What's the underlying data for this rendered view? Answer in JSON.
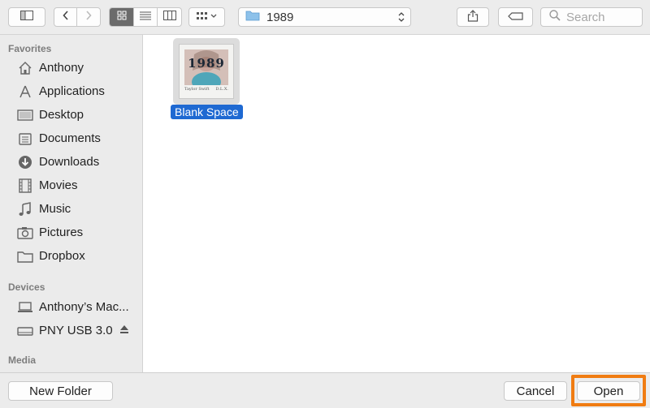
{
  "toolbar": {
    "sidebar_toggle_icon": "sidebar-icon",
    "back_icon": "chevron-left-icon",
    "forward_icon": "chevron-right-icon",
    "view_icons": [
      "icon-view-icon",
      "list-view-icon",
      "column-view-icon"
    ],
    "arrange_icon": "arrange-grid-icon",
    "path": {
      "folder_icon": "folder-icon",
      "label": "1989"
    },
    "share_icon": "share-icon",
    "tag_icon": "tag-icon",
    "search": {
      "icon": "search-icon",
      "placeholder": "Search"
    }
  },
  "sidebar": {
    "sections": [
      {
        "title": "Favorites",
        "items": [
          {
            "label": "Anthony",
            "icon": "home-icon"
          },
          {
            "label": "Applications",
            "icon": "applications-icon"
          },
          {
            "label": "Desktop",
            "icon": "desktop-icon"
          },
          {
            "label": "Documents",
            "icon": "documents-icon"
          },
          {
            "label": "Downloads",
            "icon": "downloads-icon"
          },
          {
            "label": "Movies",
            "icon": "movies-icon"
          },
          {
            "label": "Music",
            "icon": "music-icon"
          },
          {
            "label": "Pictures",
            "icon": "pictures-icon"
          },
          {
            "label": "Dropbox",
            "icon": "folder-icon"
          }
        ]
      },
      {
        "title": "Devices",
        "items": [
          {
            "label": "Anthony’s Mac...",
            "icon": "laptop-icon"
          },
          {
            "label": "PNY USB 3.0",
            "icon": "drive-icon"
          }
        ]
      },
      {
        "title": "Media",
        "items": []
      }
    ]
  },
  "main": {
    "files": [
      {
        "name": "Blank Space",
        "selected": true,
        "thumbnail": {
          "title_text": "1989",
          "caption_left": "Taylor Swift",
          "caption_right": "D.L.X."
        }
      }
    ]
  },
  "footer": {
    "new_folder_label": "New Folder",
    "cancel_label": "Cancel",
    "open_label": "Open",
    "highlight_color": "#f07c12"
  }
}
